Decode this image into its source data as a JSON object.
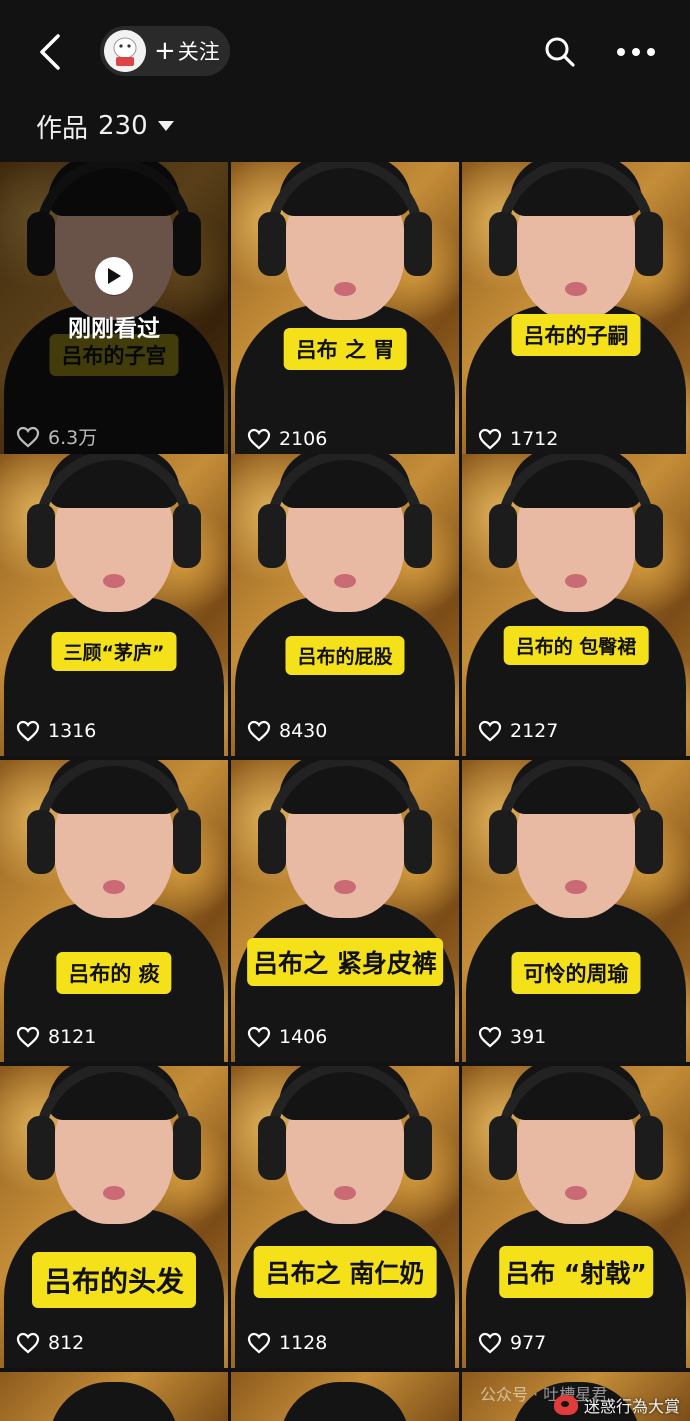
{
  "header": {
    "follow_plus": "+",
    "follow_label": "关注",
    "works_label": "作品",
    "works_count": "230"
  },
  "icons": {
    "back": "chevron-left-icon",
    "avatar": "avatar-image",
    "search": "search-icon",
    "more": "more-horizontal-icon",
    "dropdown": "caret-down-icon",
    "like": "heart-outline-icon",
    "play": "play-icon"
  },
  "colors": {
    "background": "#121212",
    "caption_bg": "#f5e11a",
    "caption_text": "#111111",
    "pill_bg": "#2a2a2a"
  },
  "watched_label": "刚刚看过",
  "videos": [
    {
      "caption": "吕布的子宫",
      "likes": "6.3万",
      "watched": true
    },
    {
      "caption": "吕布 之 胃",
      "likes": "2106"
    },
    {
      "caption": "吕布的子嗣",
      "likes": "1712"
    },
    {
      "caption": "三顾“茅庐”",
      "likes": "1316"
    },
    {
      "caption": "吕布的屁股",
      "likes": "8430"
    },
    {
      "caption": "吕布的 包臀裙",
      "likes": "2127"
    },
    {
      "caption": "吕布的 痰",
      "likes": "8121"
    },
    {
      "caption": "吕布之 紧身皮裤",
      "likes": "1406"
    },
    {
      "caption": "可怜的周瑜",
      "likes": "391"
    },
    {
      "caption": "吕布的头发",
      "likes": "812"
    },
    {
      "caption": "吕布之 南仁奶",
      "likes": "1128"
    },
    {
      "caption": "吕布 “射戟”",
      "likes": "977"
    }
  ],
  "watermark": {
    "public_prefix": "公众号 · 吐槽星君",
    "text": "迷惑行為大賞"
  }
}
